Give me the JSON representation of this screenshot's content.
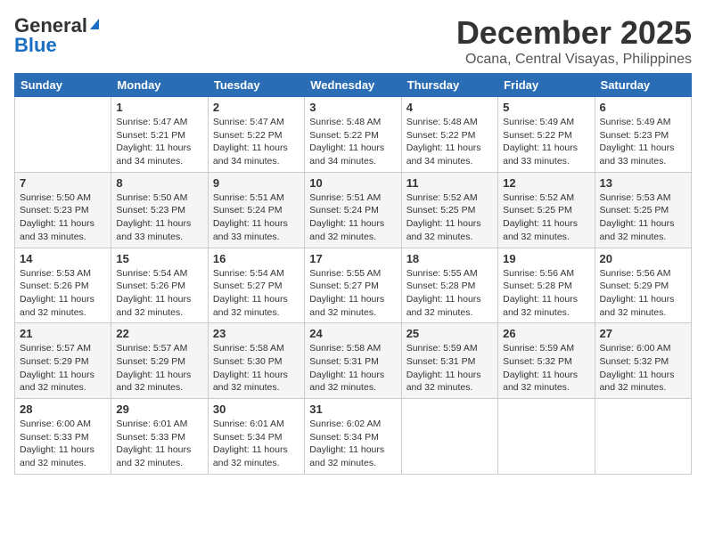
{
  "logo": {
    "line1": "General",
    "line2": "Blue"
  },
  "title": "December 2025",
  "location": "Ocana, Central Visayas, Philippines",
  "days_header": [
    "Sunday",
    "Monday",
    "Tuesday",
    "Wednesday",
    "Thursday",
    "Friday",
    "Saturday"
  ],
  "weeks": [
    [
      {
        "day": "",
        "info": ""
      },
      {
        "day": "1",
        "info": "Sunrise: 5:47 AM\nSunset: 5:21 PM\nDaylight: 11 hours\nand 34 minutes."
      },
      {
        "day": "2",
        "info": "Sunrise: 5:47 AM\nSunset: 5:22 PM\nDaylight: 11 hours\nand 34 minutes."
      },
      {
        "day": "3",
        "info": "Sunrise: 5:48 AM\nSunset: 5:22 PM\nDaylight: 11 hours\nand 34 minutes."
      },
      {
        "day": "4",
        "info": "Sunrise: 5:48 AM\nSunset: 5:22 PM\nDaylight: 11 hours\nand 34 minutes."
      },
      {
        "day": "5",
        "info": "Sunrise: 5:49 AM\nSunset: 5:22 PM\nDaylight: 11 hours\nand 33 minutes."
      },
      {
        "day": "6",
        "info": "Sunrise: 5:49 AM\nSunset: 5:23 PM\nDaylight: 11 hours\nand 33 minutes."
      }
    ],
    [
      {
        "day": "7",
        "info": "Sunrise: 5:50 AM\nSunset: 5:23 PM\nDaylight: 11 hours\nand 33 minutes."
      },
      {
        "day": "8",
        "info": "Sunrise: 5:50 AM\nSunset: 5:23 PM\nDaylight: 11 hours\nand 33 minutes."
      },
      {
        "day": "9",
        "info": "Sunrise: 5:51 AM\nSunset: 5:24 PM\nDaylight: 11 hours\nand 33 minutes."
      },
      {
        "day": "10",
        "info": "Sunrise: 5:51 AM\nSunset: 5:24 PM\nDaylight: 11 hours\nand 32 minutes."
      },
      {
        "day": "11",
        "info": "Sunrise: 5:52 AM\nSunset: 5:25 PM\nDaylight: 11 hours\nand 32 minutes."
      },
      {
        "day": "12",
        "info": "Sunrise: 5:52 AM\nSunset: 5:25 PM\nDaylight: 11 hours\nand 32 minutes."
      },
      {
        "day": "13",
        "info": "Sunrise: 5:53 AM\nSunset: 5:25 PM\nDaylight: 11 hours\nand 32 minutes."
      }
    ],
    [
      {
        "day": "14",
        "info": "Sunrise: 5:53 AM\nSunset: 5:26 PM\nDaylight: 11 hours\nand 32 minutes."
      },
      {
        "day": "15",
        "info": "Sunrise: 5:54 AM\nSunset: 5:26 PM\nDaylight: 11 hours\nand 32 minutes."
      },
      {
        "day": "16",
        "info": "Sunrise: 5:54 AM\nSunset: 5:27 PM\nDaylight: 11 hours\nand 32 minutes."
      },
      {
        "day": "17",
        "info": "Sunrise: 5:55 AM\nSunset: 5:27 PM\nDaylight: 11 hours\nand 32 minutes."
      },
      {
        "day": "18",
        "info": "Sunrise: 5:55 AM\nSunset: 5:28 PM\nDaylight: 11 hours\nand 32 minutes."
      },
      {
        "day": "19",
        "info": "Sunrise: 5:56 AM\nSunset: 5:28 PM\nDaylight: 11 hours\nand 32 minutes."
      },
      {
        "day": "20",
        "info": "Sunrise: 5:56 AM\nSunset: 5:29 PM\nDaylight: 11 hours\nand 32 minutes."
      }
    ],
    [
      {
        "day": "21",
        "info": "Sunrise: 5:57 AM\nSunset: 5:29 PM\nDaylight: 11 hours\nand 32 minutes."
      },
      {
        "day": "22",
        "info": "Sunrise: 5:57 AM\nSunset: 5:29 PM\nDaylight: 11 hours\nand 32 minutes."
      },
      {
        "day": "23",
        "info": "Sunrise: 5:58 AM\nSunset: 5:30 PM\nDaylight: 11 hours\nand 32 minutes."
      },
      {
        "day": "24",
        "info": "Sunrise: 5:58 AM\nSunset: 5:31 PM\nDaylight: 11 hours\nand 32 minutes."
      },
      {
        "day": "25",
        "info": "Sunrise: 5:59 AM\nSunset: 5:31 PM\nDaylight: 11 hours\nand 32 minutes."
      },
      {
        "day": "26",
        "info": "Sunrise: 5:59 AM\nSunset: 5:32 PM\nDaylight: 11 hours\nand 32 minutes."
      },
      {
        "day": "27",
        "info": "Sunrise: 6:00 AM\nSunset: 5:32 PM\nDaylight: 11 hours\nand 32 minutes."
      }
    ],
    [
      {
        "day": "28",
        "info": "Sunrise: 6:00 AM\nSunset: 5:33 PM\nDaylight: 11 hours\nand 32 minutes."
      },
      {
        "day": "29",
        "info": "Sunrise: 6:01 AM\nSunset: 5:33 PM\nDaylight: 11 hours\nand 32 minutes."
      },
      {
        "day": "30",
        "info": "Sunrise: 6:01 AM\nSunset: 5:34 PM\nDaylight: 11 hours\nand 32 minutes."
      },
      {
        "day": "31",
        "info": "Sunrise: 6:02 AM\nSunset: 5:34 PM\nDaylight: 11 hours\nand 32 minutes."
      },
      {
        "day": "",
        "info": ""
      },
      {
        "day": "",
        "info": ""
      },
      {
        "day": "",
        "info": ""
      }
    ]
  ]
}
